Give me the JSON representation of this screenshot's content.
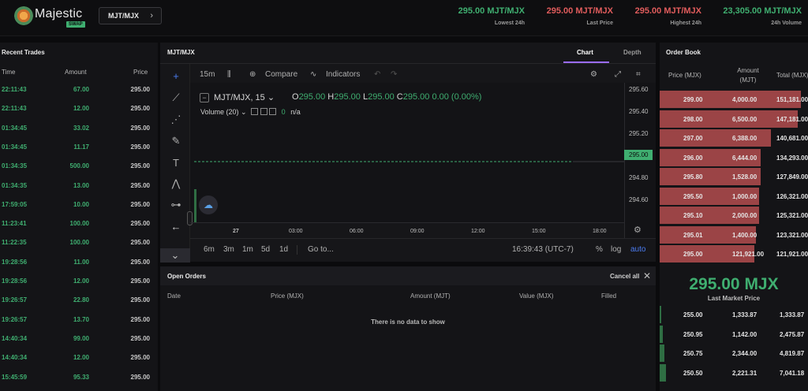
{
  "header": {
    "brand": "Majestic",
    "brand_badge": "SWAP",
    "pair_button": "MJT/MJX",
    "stats": [
      {
        "value": "295.00 MJT/MJX",
        "label": "Lowest 24h",
        "color": "#3fae70"
      },
      {
        "value": "295.00 MJT/MJX",
        "label": "Last Price",
        "color": "#e05c5c"
      },
      {
        "value": "295.00 MJT/MJX",
        "label": "Highest 24h",
        "color": "#e05c5c"
      },
      {
        "value": "23,305.00 MJT/MJX",
        "label": "24h Volume",
        "color": "#3fae70"
      }
    ]
  },
  "recent_trades": {
    "title": "Recent Trades",
    "columns": {
      "time": "Time",
      "amount": "Amount",
      "price": "Price"
    },
    "rows": [
      {
        "time": "22:11:43",
        "amount": "67.00",
        "price": "295.00"
      },
      {
        "time": "22:11:43",
        "amount": "12.00",
        "price": "295.00"
      },
      {
        "time": "01:34:45",
        "amount": "33.02",
        "price": "295.00"
      },
      {
        "time": "01:34:45",
        "amount": "11.17",
        "price": "295.00"
      },
      {
        "time": "01:34:35",
        "amount": "500.00",
        "price": "295.00"
      },
      {
        "time": "01:34:35",
        "amount": "13.00",
        "price": "295.00"
      },
      {
        "time": "17:59:05",
        "amount": "10.00",
        "price": "295.00"
      },
      {
        "time": "11:23:41",
        "amount": "100.00",
        "price": "295.00"
      },
      {
        "time": "11:22:35",
        "amount": "100.00",
        "price": "295.00"
      },
      {
        "time": "19:28:56",
        "amount": "11.00",
        "price": "295.00"
      },
      {
        "time": "19:28:56",
        "amount": "12.00",
        "price": "295.00"
      },
      {
        "time": "19:26:57",
        "amount": "22.80",
        "price": "295.00"
      },
      {
        "time": "19:26:57",
        "amount": "13.70",
        "price": "295.00"
      },
      {
        "time": "14:40:34",
        "amount": "99.00",
        "price": "295.00"
      },
      {
        "time": "14:40:34",
        "amount": "12.00",
        "price": "295.00"
      },
      {
        "time": "15:45:59",
        "amount": "95.33",
        "price": "295.00"
      }
    ]
  },
  "chart_panel": {
    "title": "MJT/MJX",
    "tabs": [
      "Chart",
      "Depth"
    ],
    "active_tab": "Chart",
    "interval": "15m",
    "compare": "Compare",
    "indicators": "Indicators",
    "symbol_label": "MJT/MJX, 15",
    "ohlc": {
      "o_label": "O",
      "o": "295.00",
      "h_label": "H",
      "h": "295.00",
      "l_label": "L",
      "l": "295.00",
      "c_label": "C",
      "c": "295.00",
      "change": "0.00 (0.00%)"
    },
    "volume_label": "Volume (20)",
    "volume_value": "0",
    "volume_na": "n/a",
    "price_ticks": [
      "295.60",
      "295.40",
      "295.20",
      "295.00",
      "294.80",
      "294.60"
    ],
    "current_price_tag": "295.00",
    "time_ticks": [
      "27",
      "03:00",
      "06:00",
      "09:00",
      "12:00",
      "15:00",
      "18:00"
    ],
    "ranges": [
      "6m",
      "3m",
      "1m",
      "5d",
      "1d"
    ],
    "goto": "Go to...",
    "clock": "16:39:43 (UTC-7)",
    "scale_options": [
      "%",
      "log",
      "auto"
    ],
    "accent": "#9a6bff"
  },
  "chart_data": {
    "type": "line",
    "x": [
      "27",
      "03:00",
      "06:00",
      "09:00",
      "12:00",
      "15:00",
      "18:00"
    ],
    "series": [
      {
        "values": [
          295.0,
          295.0,
          295.0,
          295.0,
          295.0,
          295.0,
          295.0
        ]
      }
    ],
    "ylim": [
      294.5,
      295.65
    ],
    "grid": false
  },
  "open_orders": {
    "title": "Open Orders",
    "cancel_all": "Cancel all",
    "columns": [
      "Date",
      "Price (MJX)",
      "Amount (MJT)",
      "Value (MJX)",
      "Filled"
    ],
    "empty_text": "There is no data to show"
  },
  "order_book": {
    "title": "Order Book",
    "columns": {
      "price": "Price (MJX)",
      "amount": "Amount (MJT)",
      "total": "Total (MJX)"
    },
    "asks": [
      {
        "price": "299.00",
        "amount": "4,000.00",
        "total": "151,181.00",
        "fill": 0.95
      },
      {
        "price": "298.00",
        "amount": "6,500.00",
        "total": "147,181.00",
        "fill": 0.93
      },
      {
        "price": "297.00",
        "amount": "6,388.00",
        "total": "140,681.00",
        "fill": 0.75
      },
      {
        "price": "296.00",
        "amount": "6,444.00",
        "total": "134,293.00",
        "fill": 0.68
      },
      {
        "price": "295.80",
        "amount": "1,528.00",
        "total": "127,849.00",
        "fill": 0.68
      },
      {
        "price": "295.50",
        "amount": "1,000.00",
        "total": "126,321.00",
        "fill": 0.67
      },
      {
        "price": "295.10",
        "amount": "2,000.00",
        "total": "125,321.00",
        "fill": 0.67
      },
      {
        "price": "295.01",
        "amount": "1,400.00",
        "total": "123,321.00",
        "fill": 0.65
      },
      {
        "price": "295.00",
        "amount": "121,921.00",
        "total": "121,921.00",
        "fill": 0.64
      }
    ],
    "last_price": "295.00 MJX",
    "last_price_label": "Last Market Price",
    "bids": [
      {
        "price": "255.00",
        "amount": "1,333.87",
        "total": "1,333.87",
        "fill": 0.01
      },
      {
        "price": "250.95",
        "amount": "1,142.00",
        "total": "2,475.87",
        "fill": 0.02
      },
      {
        "price": "250.75",
        "amount": "2,344.00",
        "total": "4,819.87",
        "fill": 0.03
      },
      {
        "price": "250.50",
        "amount": "2,221.31",
        "total": "7,041.18",
        "fill": 0.04
      }
    ]
  }
}
